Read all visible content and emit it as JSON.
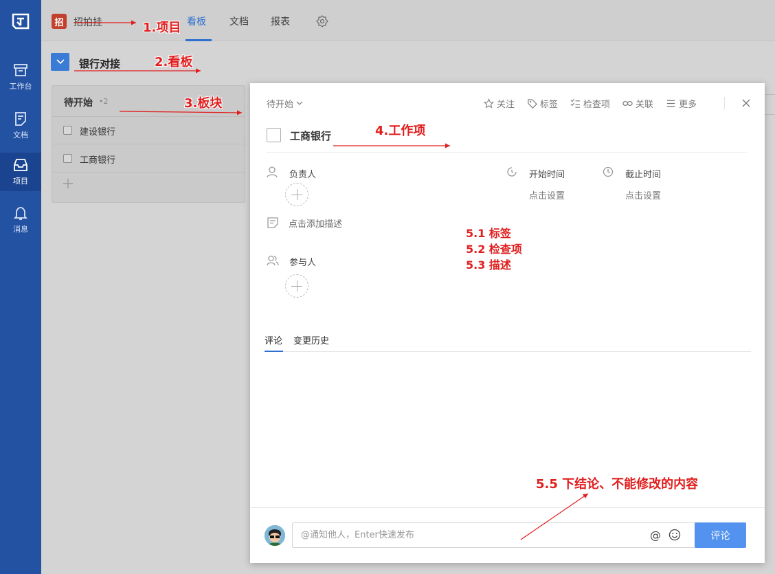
{
  "nav": {
    "items": [
      {
        "label": "工作台",
        "icon": "archive-icon"
      },
      {
        "label": "文档",
        "icon": "document-icon"
      },
      {
        "label": "项目",
        "icon": "inbox-icon"
      },
      {
        "label": "消息",
        "icon": "bell-icon"
      }
    ]
  },
  "header": {
    "project_badge": "招",
    "project_name": "招拍挂",
    "tabs": [
      "看板",
      "文档",
      "报表"
    ]
  },
  "board": {
    "name": "银行对接",
    "column": {
      "title": "待开始",
      "count": "•2",
      "cards": [
        "建设银行",
        "工商银行"
      ]
    }
  },
  "modal": {
    "status": "待开始",
    "toolbar": [
      "关注",
      "标签",
      "检查项",
      "关联",
      "更多"
    ],
    "title": "工商银行",
    "assignee_label": "负责人",
    "start_label": "开始时间",
    "start_value": "点击设置",
    "due_label": "截止时间",
    "due_value": "点击设置",
    "description_placeholder": "点击添加描述",
    "participants_label": "参与人",
    "comment_tabs": [
      "评论",
      "变更历史"
    ],
    "comment_placeholder": "@通知他人，Enter快速发布",
    "at_symbol": "@",
    "submit_label": "评论"
  },
  "annotations": {
    "a1": "1.项目",
    "a2": "2.看板",
    "a3": "3.板块",
    "a4": "4.工作项",
    "a51": "5.1 标签",
    "a52": "5.2 检查项",
    "a53": "5.3 描述",
    "a55": "5.5 下结论、不能修改的内容",
    "color": "#e01e1e"
  },
  "colors": {
    "nav_bg": "#2352a3",
    "accent": "#2e6fd0",
    "submit_bg": "#5393ef",
    "badge": "#c2402c"
  }
}
